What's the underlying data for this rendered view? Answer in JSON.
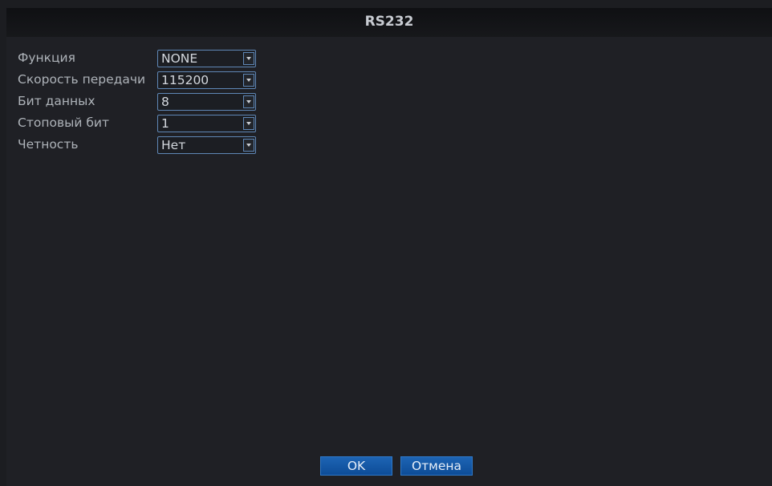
{
  "dialog": {
    "title": "RS232"
  },
  "settings": [
    {
      "label": "Функция",
      "value": "NONE"
    },
    {
      "label": "Скорость передачи",
      "value": "115200"
    },
    {
      "label": "Бит данных",
      "value": "8"
    },
    {
      "label": "Стоповый бит",
      "value": "1"
    },
    {
      "label": "Четность",
      "value": "Нет"
    }
  ],
  "buttons": {
    "ok_label": "OK",
    "cancel_label": "Отмена"
  },
  "colors": {
    "background": "#1f2025",
    "accent": "#1d64b4",
    "field_border": "#5f87b6"
  },
  "icons": {
    "dropdown": "chevron-down-icon"
  }
}
